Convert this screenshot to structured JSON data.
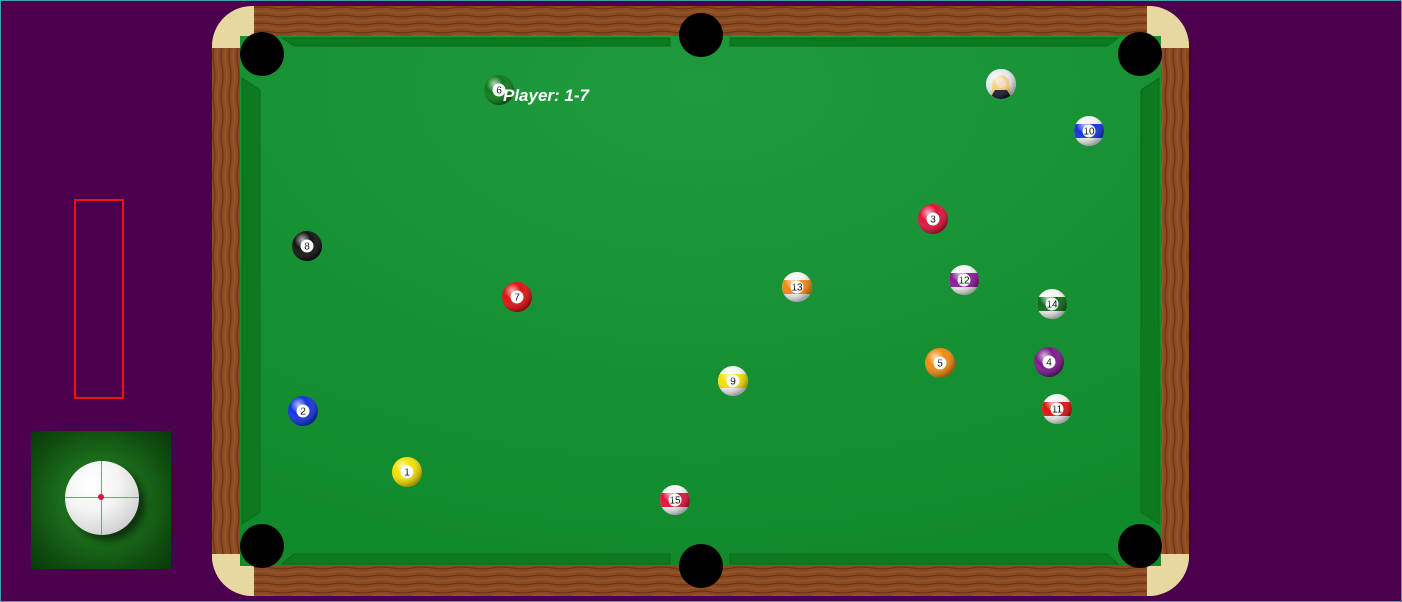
{
  "player_status": "Player: 1-7",
  "colors": {
    "background": "#4a004c",
    "felt": "#1c8f3a",
    "rail_wood": "#8a4a22",
    "corner": "#e7d7a0",
    "pocket": "#000000",
    "power_meter_border": "#ee1111",
    "aim_dot": "#e0114a"
  },
  "balls": [
    {
      "number": "6",
      "color": "#0b7a1a",
      "stripe": false
    },
    {
      "number": "",
      "color": "#f2f2f2",
      "stripe": false,
      "icon": "cue-ball-avatar-icon"
    },
    {
      "number": "10",
      "color": "#1133dd",
      "stripe": true
    },
    {
      "number": "3",
      "color": "#e0113a",
      "stripe": false
    },
    {
      "number": "8",
      "color": "#111111",
      "stripe": false
    },
    {
      "number": "7",
      "color": "#e01010",
      "stripe": false
    },
    {
      "number": "13",
      "color": "#f08a10",
      "stripe": true
    },
    {
      "number": "12",
      "color": "#8a1a9a",
      "stripe": true
    },
    {
      "number": "14",
      "color": "#0b6a1a",
      "stripe": true
    },
    {
      "number": "5",
      "color": "#f08a10",
      "stripe": false
    },
    {
      "number": "4",
      "color": "#7a1a8a",
      "stripe": false
    },
    {
      "number": "9",
      "color": "#f5e000",
      "stripe": true
    },
    {
      "number": "2",
      "color": "#1133dd",
      "stripe": false
    },
    {
      "number": "11",
      "color": "#e01010",
      "stripe": true
    },
    {
      "number": "1",
      "color": "#f5e000",
      "stripe": false
    },
    {
      "number": "15",
      "color": "#e0113a",
      "stripe": true
    }
  ]
}
